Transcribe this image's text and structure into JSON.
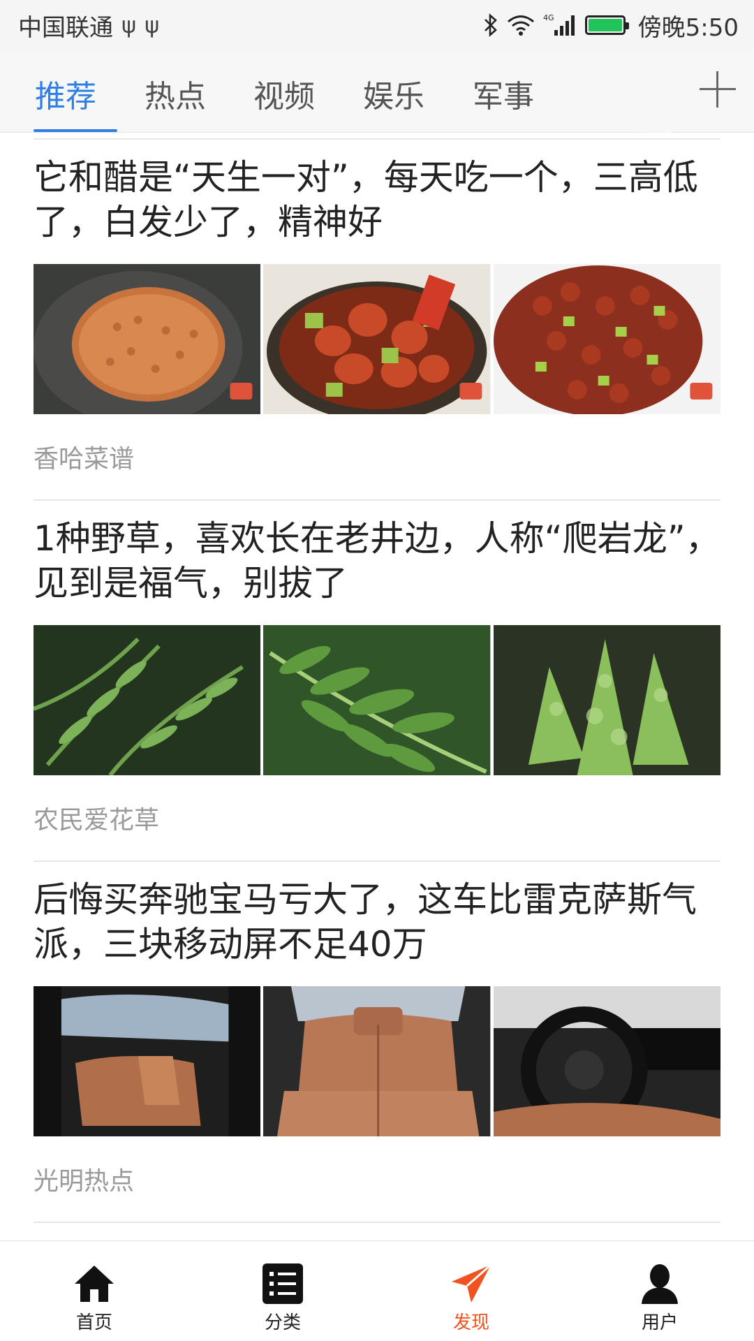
{
  "status_bar": {
    "carrier": "中国联通",
    "usb_icons": [
      "ψ",
      "ψ"
    ],
    "network": "4G",
    "time": "傍晚5:50"
  },
  "tabs": {
    "items": [
      {
        "label": "推荐",
        "active": true
      },
      {
        "label": "热点",
        "active": false
      },
      {
        "label": "视频",
        "active": false
      },
      {
        "label": "娱乐",
        "active": false
      },
      {
        "label": "军事",
        "active": false
      }
    ],
    "add_icon": "plus-icon"
  },
  "feed": {
    "articles": [
      {
        "title": "它和醋是“天生一对”，每天吃一个，三高低了，白发少了，精神好",
        "source": "香哈菜谱",
        "images": [
          "peanuts-in-pan",
          "peanut-cucumber-salad",
          "peanut-salad-plate"
        ],
        "watermarks": [
          "香哈",
          "香哈",
          "香哈"
        ]
      },
      {
        "title": "1种野草，喜欢长在老井边，人称“爬岩龙”，见到是福气，别拔了",
        "source": "农民爱花草",
        "images": [
          "fern-1",
          "fern-2",
          "fern-3"
        ],
        "watermarks": []
      },
      {
        "title": "后悔买奔驰宝马亏大了，这车比雷克萨斯气派，三块移动屏不足40万",
        "source": "光明热点",
        "images": [
          "car-rear-door",
          "car-rear-seats",
          "car-dashboard"
        ],
        "watermarks": []
      }
    ]
  },
  "bottom_nav": {
    "items": [
      {
        "label": "首页",
        "icon": "home-icon",
        "active": false
      },
      {
        "label": "分类",
        "icon": "list-icon",
        "active": false
      },
      {
        "label": "发现",
        "icon": "send-icon",
        "active": true
      },
      {
        "label": "用户",
        "icon": "user-icon",
        "active": false
      }
    ]
  },
  "colors": {
    "accent_blue": "#2f7fe6",
    "accent_orange": "#f0531e",
    "source_gray": "#9a9a9a"
  }
}
